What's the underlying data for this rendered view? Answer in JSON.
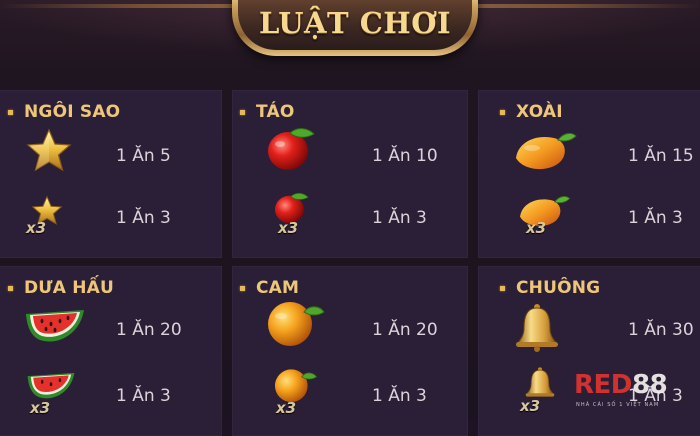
{
  "title": "LUẬT CHƠI",
  "panels": [
    {
      "name": "NGÔI SAO",
      "icon": "star-icon",
      "rows": [
        {
          "multiplier": "",
          "payout": "1 Ăn 5"
        },
        {
          "multiplier": "x3",
          "payout": "1 Ăn 3"
        }
      ]
    },
    {
      "name": "TÁO",
      "icon": "apple-icon",
      "rows": [
        {
          "multiplier": "",
          "payout": "1 Ăn 10"
        },
        {
          "multiplier": "x3",
          "payout": "1 Ăn 3"
        }
      ]
    },
    {
      "name": "XOÀI",
      "icon": "mango-icon",
      "rows": [
        {
          "multiplier": "",
          "payout": "1 Ăn 15"
        },
        {
          "multiplier": "x3",
          "payout": "1 Ăn 3"
        }
      ]
    },
    {
      "name": "DƯA HẤU",
      "icon": "watermelon-icon",
      "rows": [
        {
          "multiplier": "",
          "payout": "1 Ăn 20"
        },
        {
          "multiplier": "x3",
          "payout": "1 Ăn 3"
        }
      ]
    },
    {
      "name": "CAM",
      "icon": "orange-icon",
      "rows": [
        {
          "multiplier": "",
          "payout": "1 Ăn 20"
        },
        {
          "multiplier": "x3",
          "payout": "1 Ăn 3"
        }
      ]
    },
    {
      "name": "CHUÔNG",
      "icon": "bell-icon",
      "rows": [
        {
          "multiplier": "",
          "payout": "1 Ăn 30"
        },
        {
          "multiplier": "x3",
          "payout": "1 Ăn 3"
        }
      ]
    }
  ],
  "watermark": {
    "brand_red": "RED",
    "brand_number": "88",
    "tagline": "NHÀ CÁI SỐ 1 VIỆT NAM"
  },
  "colors": {
    "background": "#1e1322",
    "panel": "#2b1f37",
    "panel_title": "#eec679",
    "payout_text": "#dcd3da",
    "title_text": "#f6d98e"
  }
}
